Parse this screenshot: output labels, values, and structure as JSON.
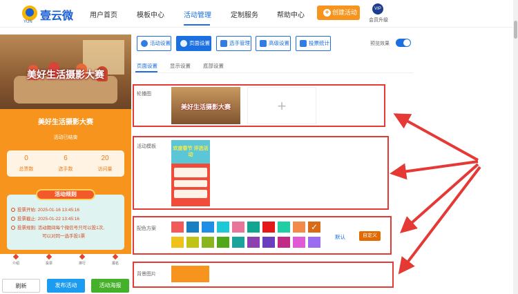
{
  "nav": {
    "logo": "壹云微",
    "logo_sub": "YUN",
    "items": [
      "用户首页",
      "模板中心",
      "活动管理",
      "定制服务",
      "帮助中心"
    ],
    "active_index": 2,
    "create_btn": "创建活动",
    "vip_badge": "VIP",
    "vip_label": "会员升级"
  },
  "preview": {
    "banner_title": "美好生活摄影大赛",
    "title": "美好生活摄影大赛",
    "status": "活动已结束",
    "stats": [
      {
        "value": "0",
        "label": "总票数"
      },
      {
        "value": "6",
        "label": "选手数"
      },
      {
        "value": "20",
        "label": "访问量"
      }
    ],
    "rules_title": "活动规则",
    "rules": [
      "投票开始: 2025-01-16 13:45:16",
      "投票截止: 2025-01-22 13:45:16",
      "投票规则: 活动期间每个微信号只可以投1次,",
      "可以对同一选手投1票"
    ],
    "tabs": [
      "介绍",
      "投票",
      "排行",
      "报名"
    ]
  },
  "bottom": {
    "refresh": "刷新",
    "publish": "发布活动",
    "poster": "活动海报"
  },
  "toolbar": {
    "buttons": [
      "活动设置",
      "页面设置",
      "选手管理",
      "高级设置",
      "投票统计"
    ],
    "active_index": 1,
    "preview_label": "预览效果"
  },
  "subtabs": [
    "页面设置",
    "显示设置",
    "底部设置"
  ],
  "sections": {
    "carousel_label": "轮播图",
    "carousel_image_text": "美好生活摄影大赛",
    "template_label": "活动模板",
    "template_title": "欢度春节 评选活动",
    "color_label": "配色方案",
    "default_link": "默认",
    "custom_btn": "自定义",
    "bg_label": "背景图片"
  },
  "colors": {
    "row1": [
      "#f25a5a",
      "#1a7fc1",
      "#1e8ee6",
      "#1ec8d6",
      "#e8759a",
      "#12a58f",
      "#e51919",
      "#1fcfa3",
      "#f28a4a",
      "#d96b16"
    ],
    "row2": [
      "#eec21a",
      "#bfc417",
      "#8ab51e",
      "#52a81a",
      "#19a39a",
      "#8e3fb0",
      "#6a3fbf",
      "#c12a86",
      "#e05ad6",
      "#9b6cf0"
    ],
    "selected": "#d96b16",
    "accent": "#1b6fe0",
    "orange": "#f7941d",
    "annotation": "#e53935"
  }
}
